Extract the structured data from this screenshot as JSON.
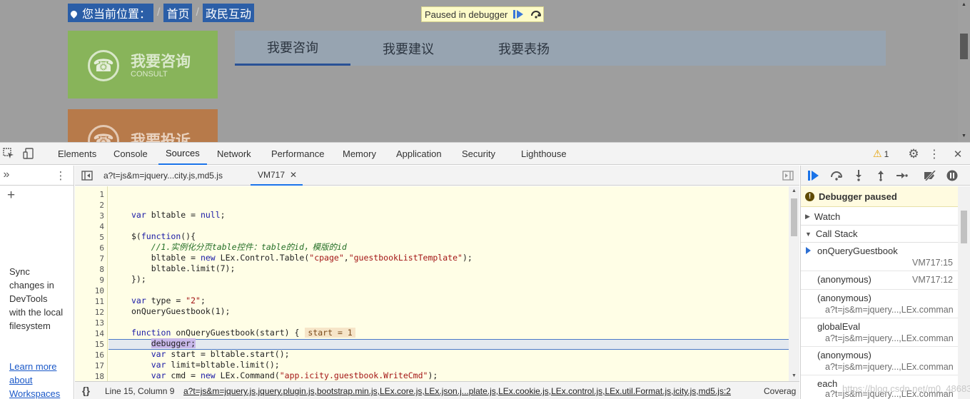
{
  "page": {
    "breadcrumb": {
      "label": "您当前位置：",
      "home": "首页",
      "current": "政民互动",
      "sep": "/"
    },
    "paused_overlay": {
      "text": "Paused in debugger"
    },
    "cards": [
      {
        "title": "我要咨询",
        "subtitle": "CONSULT",
        "icon": "☎"
      },
      {
        "title": "我要投诉",
        "subtitle": "",
        "icon": "☎"
      }
    ],
    "tabs": [
      "我要咨询",
      "我要建议",
      "我要表扬"
    ]
  },
  "devtools": {
    "tabs": [
      "Elements",
      "Console",
      "Sources",
      "Network",
      "Performance",
      "Memory",
      "Application",
      "Security",
      "Lighthouse"
    ],
    "active_tab": "Sources",
    "warnings": "1",
    "navigator": {
      "expand": "»",
      "add": "+",
      "sync_text": "Sync changes in DevTools with the local filesystem",
      "link": "Learn more about Workspaces"
    },
    "file_tabs": [
      {
        "label": "a?t=js&m=jquery...city.js,md5.js",
        "closable": false
      },
      {
        "label": "VM717",
        "closable": true,
        "close": "✕"
      }
    ],
    "code": {
      "line_numbers": [
        "1",
        "2",
        "3",
        "4",
        "5",
        "6",
        "7",
        "8",
        "9",
        "10",
        "11",
        "12",
        "13",
        "14",
        "15",
        "16",
        "17",
        "18"
      ],
      "inline_value": "start = 1"
    },
    "status": {
      "position": "Line 15, Column 9",
      "source": "a?t=js&m=jquery.js,jquery.plugin.js,bootstrap.min.js,LEx.core.js,LEx.json.j...plate.js,LEx.cookie.js,LEx.control.js,LEx.util.Format.js,icity.js,md5.js:2",
      "coverage": "Coverag"
    },
    "debugger": {
      "paused": "Debugger paused",
      "watch": "Watch",
      "call_stack": "Call Stack",
      "frames": [
        {
          "fn": "onQueryGuestbook",
          "loc": "VM717:15"
        },
        {
          "fn": "(anonymous)",
          "loc": "VM717:12"
        },
        {
          "fn": "(anonymous)",
          "loc": "a?t=js&m=jquery...,LEx.comman"
        },
        {
          "fn": "globalEval",
          "loc": "a?t=js&m=jquery...,LEx.comman"
        },
        {
          "fn": "(anonymous)",
          "loc": "a?t=js&m=jquery...,LEx.comman"
        },
        {
          "fn": "each",
          "loc": "a?t=js&m=jquery...,LEx.comman"
        }
      ]
    },
    "watermark": "https://blog.csdn.net/m0_48683048"
  }
}
